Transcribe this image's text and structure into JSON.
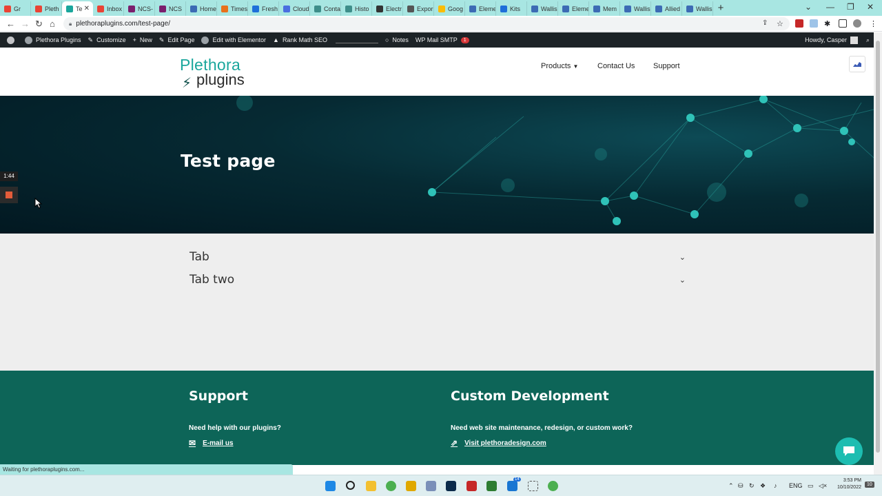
{
  "browser": {
    "tabs": [
      {
        "label": "Gr",
        "color": "#ea4335"
      },
      {
        "label": "Pleth",
        "color": "#ea4335"
      },
      {
        "label": "Te",
        "color": "#1aa69c",
        "active": true
      },
      {
        "label": "Inbox",
        "color": "#ea4335"
      },
      {
        "label": "NCS-",
        "color": "#7b1f6d"
      },
      {
        "label": "NCS",
        "color": "#7b1f6d"
      },
      {
        "label": "Home",
        "color": "#3c6bb4"
      },
      {
        "label": "Times",
        "color": "#e8711c"
      },
      {
        "label": "Fresh",
        "color": "#1e6fd9"
      },
      {
        "label": "Cloud",
        "color": "#4a6ee0"
      },
      {
        "label": "Conta",
        "color": "#3e8e8a"
      },
      {
        "label": "Histo",
        "color": "#3e8e8a"
      },
      {
        "label": "Electr",
        "color": "#333333"
      },
      {
        "label": "Expor",
        "color": "#555555"
      },
      {
        "label": "Goog",
        "color": "#fbbc04"
      },
      {
        "label": "Eleme",
        "color": "#3c6bb4"
      },
      {
        "label": "Kits",
        "color": "#1e6fd9"
      },
      {
        "label": "Wallis",
        "color": "#3c6bb4"
      },
      {
        "label": "Eleme",
        "color": "#3c6bb4"
      },
      {
        "label": "Mem",
        "color": "#3c6bb4"
      },
      {
        "label": "Wallis",
        "color": "#3c6bb4"
      },
      {
        "label": "Allied",
        "color": "#3c6bb4"
      },
      {
        "label": "Wallis",
        "color": "#3c6bb4"
      }
    ],
    "url": "plethoraplugins.com/test-page/",
    "status_text": "Waiting for plethoraplugins.com..."
  },
  "adminbar": {
    "site_name": "Plethora Plugins",
    "customize": "Customize",
    "new": "New",
    "edit_page": "Edit Page",
    "elementor": "Edit with Elementor",
    "rankmath": "Rank Math SEO",
    "notes": "Notes",
    "smtp": "WP Mail SMTP",
    "smtp_count": "1",
    "howdy": "Howdy, Casper"
  },
  "site": {
    "logo_line1": "Plethora",
    "logo_line2": "plugins",
    "menu": {
      "products": "Products",
      "contact": "Contact Us",
      "support": "Support"
    }
  },
  "hero": {
    "title": "Test page"
  },
  "accordion": [
    {
      "label": "Tab"
    },
    {
      "label": "Tab two"
    }
  ],
  "footer": {
    "support_heading": "Support",
    "support_text": "Need help with our plugins?",
    "support_link": "E-mail us",
    "dev_heading": "Custom Development",
    "dev_text": "Need web site maintenance, redesign, or custom work?",
    "dev_link": "Visit plethoradesign.com"
  },
  "overlay": {
    "timer": "1:44"
  },
  "taskbar": {
    "lang": "ENG",
    "time": "3:53 PM",
    "date": "10/10/2022",
    "notif": "10",
    "badge": "14"
  },
  "colors": {
    "brand_teal": "#1aa69c",
    "footer_bg": "#0d6558",
    "admin_bar": "#1d2327"
  }
}
